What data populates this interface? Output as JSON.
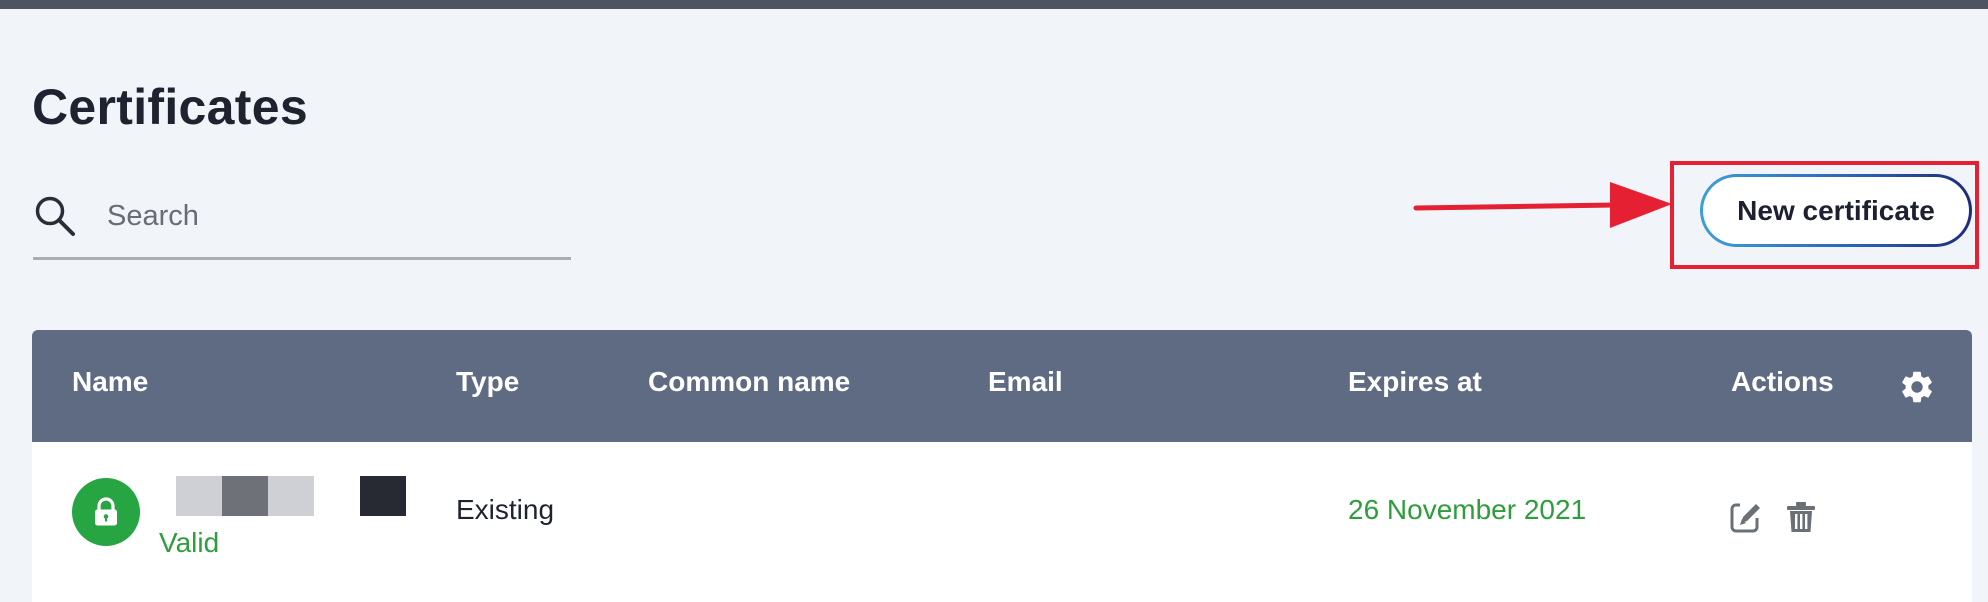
{
  "page": {
    "title": "Certificates"
  },
  "search": {
    "placeholder": "Search",
    "value": ""
  },
  "toolbar": {
    "new_certificate_label": "New certificate"
  },
  "annotation": {
    "color": "#e62033"
  },
  "table": {
    "columns": [
      "Name",
      "Type",
      "Common name",
      "Email",
      "Expires at",
      "Actions"
    ],
    "header_color": "#5e6b83",
    "rows": [
      {
        "status": "Valid",
        "status_color": "#2e9e3c",
        "status_icon": "lock-icon",
        "name": "",
        "type": "Existing",
        "common_name": "",
        "email": "",
        "expires_at": "26 November 2021",
        "actions": [
          "edit-icon",
          "trash-icon"
        ]
      }
    ]
  },
  "icons": {
    "search": "search-icon",
    "settings": "gear-icon"
  }
}
